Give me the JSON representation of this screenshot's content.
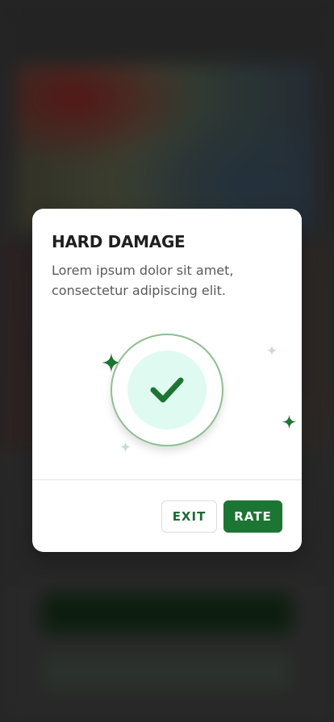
{
  "modal": {
    "title": "HARD DAMAGE",
    "body": "Lorem ipsum dolor sit amet, consectetur adipiscing elit.",
    "exit_label": "EXIT",
    "rate_label": "RATE"
  },
  "illustration": {
    "icon": "checkmark-icon",
    "sparkle_icon": "sparkle-icon"
  },
  "colors": {
    "accent": "#1d7533",
    "accent_light": "#dffbf1",
    "ring_border": "#8fbe93",
    "sparkle_faint": "#c9dccb"
  }
}
